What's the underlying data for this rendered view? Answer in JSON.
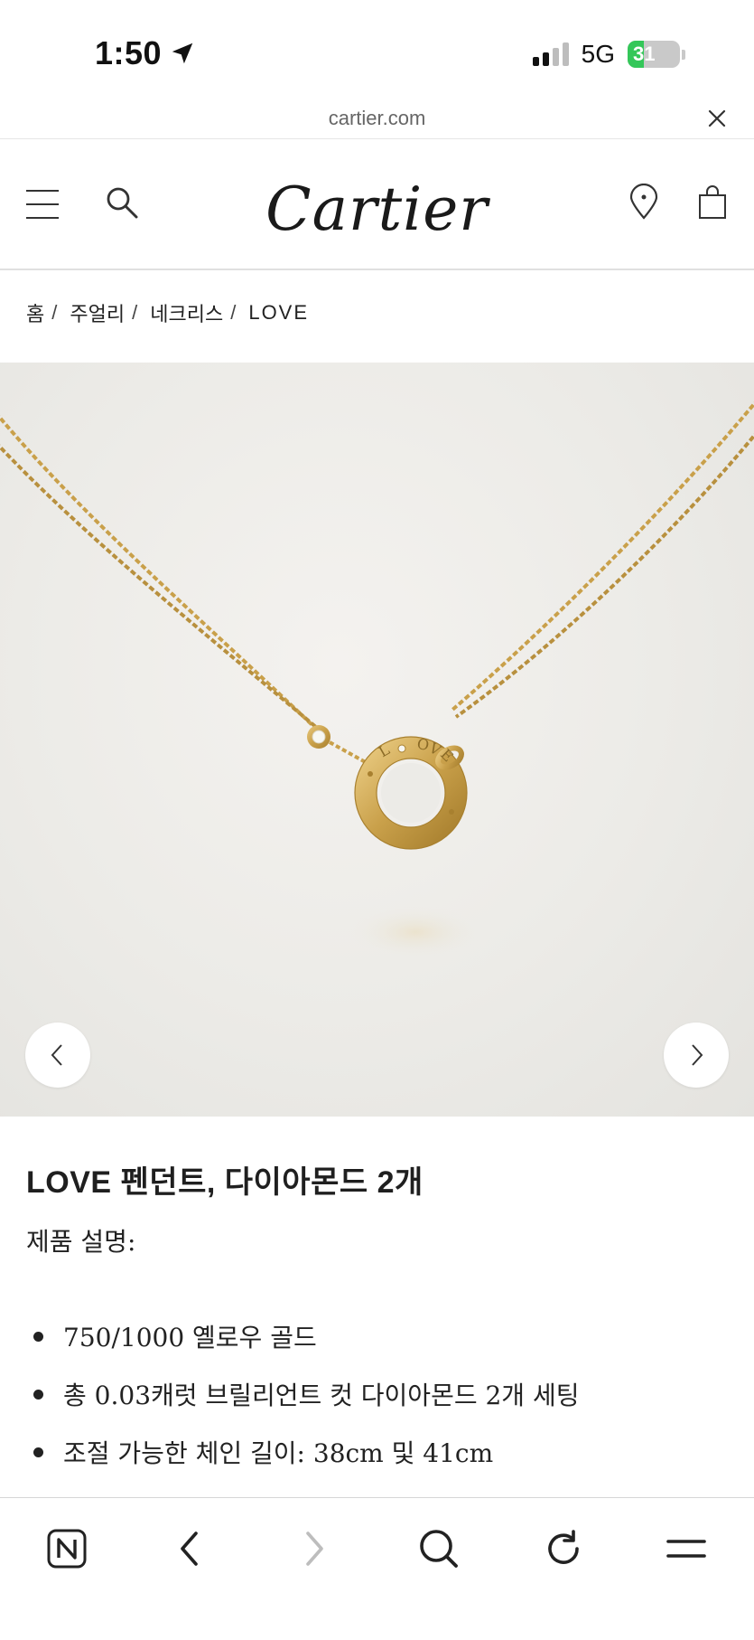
{
  "status_bar": {
    "time": "1:50",
    "network": "5G",
    "battery": "31",
    "battery_level": 0.31,
    "icons": [
      "location-arrow-icon",
      "signal-bars-icon",
      "battery-icon"
    ]
  },
  "url_bar": {
    "domain": "cartier.com"
  },
  "header": {
    "logo": "Cartier",
    "icons": [
      "menu-icon",
      "search-icon",
      "store-locator-icon",
      "shopping-bag-icon"
    ]
  },
  "breadcrumb": {
    "items": [
      "홈",
      "주얼리",
      "네크리스",
      "LOVE"
    ],
    "separator": "/"
  },
  "product": {
    "image_alt": "LOVE 펜던트 옐로우 골드 목걸이",
    "title": "LOVE 펜던트, 다이아몬드 2개",
    "description_label": "제품 설명:",
    "features": [
      "750/1000 옐로우 골드",
      "총 0.03캐럿 브릴리언트 컷 다이아몬드 2개 세팅",
      "조절 가능한 체인 길이: 38cm 및 41cm"
    ],
    "pendant_engraving": [
      "L",
      "O",
      "V",
      "E"
    ]
  },
  "toolbar": {
    "items": [
      "naver-home-icon",
      "back-icon",
      "forward-icon",
      "search-icon",
      "reload-icon",
      "menu-icon"
    ]
  },
  "colors": {
    "gold": "#c9a04a",
    "gold_light": "#e3c277",
    "hero_bg": "#ecebe7",
    "battery_green": "#34c759"
  }
}
